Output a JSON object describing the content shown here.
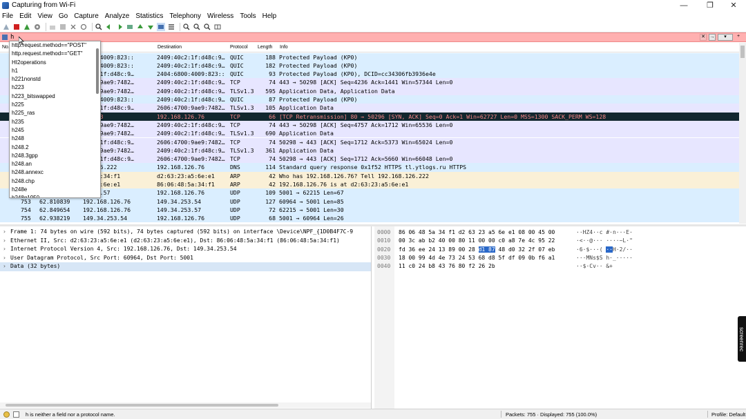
{
  "window": {
    "title": "Capturing from Wi-Fi",
    "controls": [
      "—",
      "❐",
      "✕"
    ]
  },
  "menu": [
    "File",
    "Edit",
    "View",
    "Go",
    "Capture",
    "Analyze",
    "Statistics",
    "Telephony",
    "Wireless",
    "Tools",
    "Help"
  ],
  "filter": {
    "value": "h"
  },
  "columns": {
    "no": "No.",
    "destination": "Destination",
    "protocol": "Protocol",
    "length": "Length",
    "info": "Info"
  },
  "packets": [
    {
      "time": "",
      "source": "6800:4009:823::",
      "destination": "2409:40c2:1f:d48c:9…",
      "protocol": "QUIC",
      "length": "188",
      "info": "Protected Payload (KP0)",
      "color": "quic"
    },
    {
      "time": "",
      "source": "6800:4009:823::",
      "destination": "2409:40c2:1f:d48c:9…",
      "protocol": "QUIC",
      "length": "182",
      "info": "Protected Payload (KP0)",
      "color": "quic"
    },
    {
      "time": "",
      "source": "40c2:1f:d48c:9…",
      "destination": "2404:6800:4009:823::",
      "protocol": "QUIC",
      "length": "93",
      "info": "Protected Payload (KP0), DCID=cc34306fb3936e4e",
      "color": "quic"
    },
    {
      "time": "",
      "source": "4700:9ae9:7482…",
      "destination": "2409:40c2:1f:d48c:9…",
      "protocol": "TCP",
      "length": "74",
      "info": "443 → 50298 [ACK] Seq=4236 Ack=1441 Win=57344 Len=0",
      "color": "tcp"
    },
    {
      "time": "",
      "source": "4700:9ae9:7482…",
      "destination": "2409:40c2:1f:d48c:9…",
      "protocol": "TLSv1.3",
      "length": "595",
      "info": "Application Data, Application Data",
      "color": "tcp"
    },
    {
      "time": "",
      "source": "6800:4009:823::",
      "destination": "2409:40c2:1f:d48c:9…",
      "protocol": "QUIC",
      "length": "87",
      "info": "Protected Payload (KP0)",
      "color": "quic"
    },
    {
      "time": "",
      "source": "40c2:1f:d48c:9…",
      "destination": "2606:4700:9ae9:7482…",
      "protocol": "TLSv1.3",
      "length": "105",
      "info": "Application Data",
      "color": "tcp"
    },
    {
      "time": "",
      "source": ".249.3",
      "destination": "192.168.126.76",
      "protocol": "TCP",
      "length": "66",
      "info": "[TCP Retransmission] 80 → 50296 [SYN, ACK] Seq=0 Ack=1 Win=62727 Len=0 MSS=1300 SACK_PERM WS=128",
      "color": "sel"
    },
    {
      "time": "",
      "source": "4700:9ae9:7482…",
      "destination": "2409:40c2:1f:d48c:9…",
      "protocol": "TCP",
      "length": "74",
      "info": "443 → 50298 [ACK] Seq=4757 Ack=1712 Win=65536 Len=0",
      "color": "tcp"
    },
    {
      "time": "",
      "source": "4700:9ae9:7482…",
      "destination": "2409:40c2:1f:d48c:9…",
      "protocol": "TLSv1.3",
      "length": "690",
      "info": "Application Data",
      "color": "tcp"
    },
    {
      "time": "",
      "source": "40c2:1f:d48c:9…",
      "destination": "2606:4700:9ae9:7482…",
      "protocol": "TCP",
      "length": "74",
      "info": "50298 → 443 [ACK] Seq=1712 Ack=5373 Win=65024 Len=0",
      "color": "tcp"
    },
    {
      "time": "",
      "source": "4700:9ae9:7482…",
      "destination": "2409:40c2:1f:d48c:9…",
      "protocol": "TLSv1.3",
      "length": "361",
      "info": "Application Data",
      "color": "tcp"
    },
    {
      "time": "",
      "source": "40c2:1f:d48c:9…",
      "destination": "2606:4700:9ae9:7482…",
      "protocol": "TCP",
      "length": "74",
      "info": "50298 → 443 [ACK] Seq=1712 Ack=5660 Win=66048 Len=0",
      "color": "tcp"
    },
    {
      "time": "",
      "source": "68.126.222",
      "destination": "192.168.126.76",
      "protocol": "DNS",
      "length": "114",
      "info": "Standard query response 0x1f52 HTTPS tl.ytlogs.ru HTTPS",
      "color": "udp"
    },
    {
      "time": "",
      "source": "48:5a:34:f1",
      "destination": "d2:63:23:a5:6e:e1",
      "protocol": "ARP",
      "length": "42",
      "info": "Who has 192.168.126.76? Tell 192.168.126.222",
      "color": "arp"
    },
    {
      "time": "",
      "source": "23:a5:6e:e1",
      "destination": "86:06:48:5a:34:f1",
      "protocol": "ARP",
      "length": "42",
      "info": "192.168.126.76 is at d2:63:23:a5:6e:e1",
      "color": "arp"
    },
    {
      "time": "",
      "source": "4.253.57",
      "destination": "192.168.126.76",
      "protocol": "UDP",
      "length": "109",
      "info": "5001 → 62215 Len=67",
      "color": "udp"
    },
    {
      "no": "753",
      "time": "62.810839",
      "source": "192.168.126.76",
      "destination": "149.34.253.54",
      "protocol": "UDP",
      "length": "127",
      "info": "60964 → 5001 Len=85",
      "color": "udp"
    },
    {
      "no": "754",
      "time": "62.849654",
      "source": "192.168.126.76",
      "destination": "149.34.253.57",
      "protocol": "UDP",
      "length": "72",
      "info": "62215 → 5001 Len=30",
      "color": "udp"
    },
    {
      "no": "755",
      "time": "62.938219",
      "source": "149.34.253.54",
      "destination": "192.168.126.76",
      "protocol": "UDP",
      "length": "68",
      "info": "5001 → 60964 Len=26",
      "color": "udp"
    }
  ],
  "autocomplete": [
    "http.request.method==\"POST\"",
    "http.request.method==\"GET\"",
    "HI2operations",
    "h1",
    "h221nonstd",
    "h223",
    "h223_bitswapped",
    "h225",
    "h225_ras",
    "h235",
    "h245",
    "h248",
    "h248.2",
    "h248.3gpp",
    "h248.an",
    "h248.annexc",
    "h248.chp",
    "h248e",
    "h248q1950",
    "h261"
  ],
  "details": [
    "Frame 1: 74 bytes on wire (592 bits), 74 bytes captured (592 bits) on interface \\Device\\NPF_{1D0B4F7C-9",
    "Ethernet II, Src: d2:63:23:a5:6e:e1 (d2:63:23:a5:6e:e1), Dst: 86:06:48:5a:34:f1 (86:06:48:5a:34:f1)",
    "Internet Protocol Version 4, Src: 192.168.126.76, Dst: 149.34.253.54",
    "User Datagram Protocol, Src Port: 60964, Dst Port: 5001",
    "Data (32 bytes)"
  ],
  "bytes": [
    {
      "off": "0000",
      "hex_a": "86 06 48 5a 34 f1 d2 63  23 a5 6e e1 08 00 45 00",
      "hl": "",
      "hex_b": "",
      "ascii_a": "··HZ4··c #·n···E·",
      "ascii_hl": "",
      "ascii_b": ""
    },
    {
      "off": "0010",
      "hex_a": "00 3c ab b2 40 00 80 11  00 00 c0 a8 7e 4c 95 22",
      "hl": "",
      "hex_b": "",
      "ascii_a": "·<··@··· ····~L·\"",
      "ascii_hl": "",
      "ascii_b": ""
    },
    {
      "off": "0020",
      "hex_a": "fd 36 ee 24 13 89 00 28  ",
      "hl": "d1 87",
      "hex_b": " 48 d0 32 2f 07 eb",
      "ascii_a": "·6·$···( ",
      "ascii_hl": "··",
      "ascii_b": "H·2/··"
    },
    {
      "off": "0030",
      "hex_a": "18 00 99 4d 4e 73 24 53  68 d8 5f df 09 0b f6 a1",
      "hl": "",
      "hex_b": "",
      "ascii_a": "···MNs$S h·_·····",
      "ascii_hl": "",
      "ascii_b": ""
    },
    {
      "off": "0040",
      "hex_a": "11 c0 24 b8 43 76 80 f2  26 2b",
      "hl": "",
      "hex_b": "",
      "ascii_a": "··$·Cv·· &+",
      "ascii_hl": "",
      "ascii_b": ""
    }
  ],
  "status": {
    "message": "h is neither a field nor a protocol name.",
    "packets": "Packets: 755 · Displayed: 755 (100.0%)",
    "profile": "Profile: Default"
  },
  "badge": "screenrec"
}
